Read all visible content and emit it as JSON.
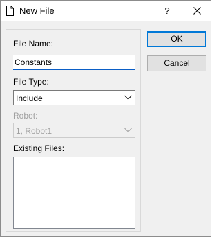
{
  "window": {
    "title": "New File",
    "help_label": "?"
  },
  "form": {
    "file_name_label": "File Name:",
    "file_name_value": "Constants",
    "file_type_label": "File Type:",
    "file_type_value": "Include",
    "robot_label": "Robot:",
    "robot_value": "1, Robot1",
    "existing_files_label": "Existing Files:",
    "existing_files": []
  },
  "buttons": {
    "ok_label": "OK",
    "cancel_label": "Cancel"
  },
  "icons": {
    "title": "document-icon",
    "close": "close-icon",
    "dropdown": "chevron-down-icon"
  },
  "colors": {
    "accent": "#0078d7",
    "input_underline": "#0b5ec6",
    "disabled_text": "#a0a0a0",
    "dialog_bg": "#f0f0f0"
  }
}
